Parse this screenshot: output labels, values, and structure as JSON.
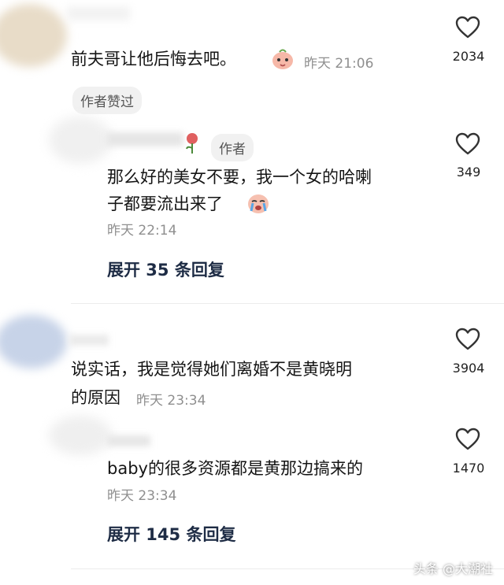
{
  "comments": [
    {
      "text": "前夫哥让他后悔去吧。",
      "time": "昨天 21:06",
      "likes": "2034",
      "author_liked_tag": "作者赞过",
      "reply": {
        "author_tag": "作者",
        "text_line1": "那么好的美女不要，我一个女的哈喇",
        "text_line2": "子都要流出来了",
        "time": "昨天 22:14",
        "likes": "349"
      },
      "expand_label": "展开 35 条回复"
    },
    {
      "text_line1": "说实话，我是觉得她们离婚不是黄晓明",
      "text_line2": "的原因",
      "time": "昨天 23:34",
      "likes": "3904",
      "reply": {
        "text": "baby的很多资源都是黄那边搞来的",
        "time": "昨天 23:34",
        "likes": "1470"
      },
      "expand_label": "展开 145 条回复"
    }
  ],
  "watermark": "头条 @大潮社",
  "colors": {
    "expand": "#1e2c45",
    "time": "#8f8f8f",
    "tag_bg": "#f1f1f1"
  }
}
